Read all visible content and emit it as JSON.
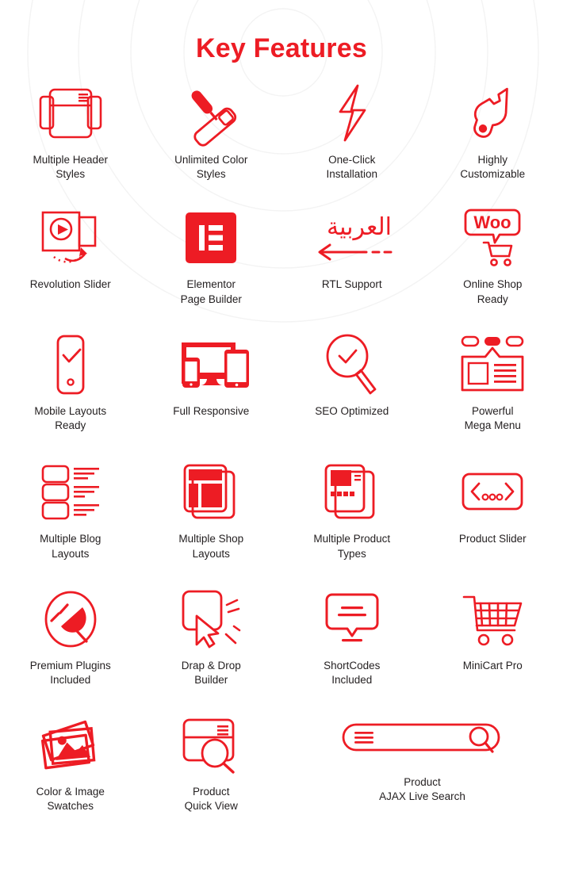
{
  "theme": {
    "brand_red": "#ED1C24",
    "label_color": "#231F20",
    "background": "#FFFFFF",
    "ring_color": "#F4F4F4"
  },
  "header": {
    "title": "Key Features"
  },
  "features": {
    "rows": [
      {
        "items": [
          {
            "label": "Multiple Header\nStyles",
            "icon": "header-layout-icon"
          },
          {
            "label": "Unlimited Color\nStyles",
            "icon": "paint-roller-icon"
          },
          {
            "label": "One-Click\nInstallation",
            "icon": "lightning-bolt-icon"
          },
          {
            "label": "Highly\nCustomizable",
            "icon": "wrench-icon"
          }
        ]
      },
      {
        "items": [
          {
            "label": "Revolution Slider",
            "icon": "video-slider-icon"
          },
          {
            "label": "Elementor\nPage Builder",
            "icon": "elementor-icon"
          },
          {
            "label": "RTL Support",
            "icon": "rtl-arabic-arrow-icon"
          },
          {
            "label": "Online Shop\nReady",
            "icon": "woocommerce-cart-icon"
          }
        ]
      },
      {
        "items": [
          {
            "label": "Mobile Layouts\nReady",
            "icon": "mobile-check-icon"
          },
          {
            "label": "Full Responsive",
            "icon": "multi-device-icon"
          },
          {
            "label": "SEO Optimized",
            "icon": "magnifier-check-icon"
          },
          {
            "label": "Powerful\nMega Menu",
            "icon": "mega-menu-icon"
          }
        ]
      },
      {
        "items": [
          {
            "label": "Multiple Blog\nLayouts",
            "icon": "blog-list-icon"
          },
          {
            "label": "Multiple Shop\nLayouts",
            "icon": "shop-pages-icon"
          },
          {
            "label": "Multiple Product\nTypes",
            "icon": "product-pages-icon"
          },
          {
            "label": "Product Slider",
            "icon": "carousel-arrows-icon"
          }
        ]
      },
      {
        "items": [
          {
            "label": "Premium Plugins\nIncluded",
            "icon": "plug-circle-icon"
          },
          {
            "label": "Drap & Drop\nBuilder",
            "icon": "drag-drop-cursor-icon"
          },
          {
            "label": "ShortCodes\nIncluded",
            "icon": "speech-bubble-lines-icon"
          },
          {
            "label": "MiniCart Pro",
            "icon": "shopping-cart-icon"
          }
        ]
      },
      {
        "items": [
          {
            "label": "Color & Image\nSwatches",
            "icon": "photo-stack-icon"
          },
          {
            "label": "Product\nQuick View",
            "icon": "quick-view-magnifier-icon"
          },
          {
            "label": "Product\nAJAX Live Search",
            "icon": "search-bar-icon"
          }
        ]
      }
    ]
  }
}
